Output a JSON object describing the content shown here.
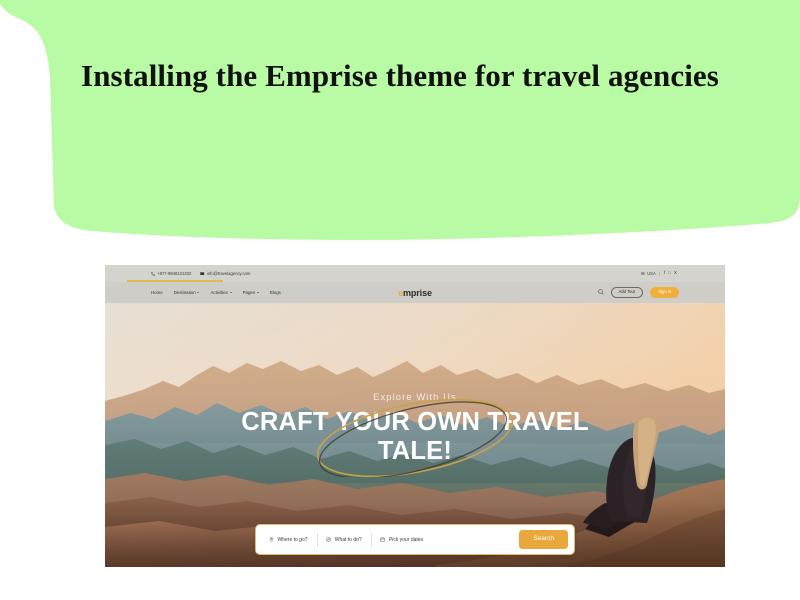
{
  "slide": {
    "title": "Installing the Emprise theme for travel agencies",
    "background_color": "#b9fba5",
    "page_background": "#ffffff"
  },
  "site": {
    "topbar": {
      "phone": "+977-9848131232",
      "phone_icon": "phone-icon",
      "email": "info@travelagency.com",
      "email_icon": "mail-icon",
      "locale": "USA",
      "locale_icon": "globe-icon",
      "separator": "|",
      "social": [
        {
          "name": "facebook-icon",
          "glyph": "f"
        },
        {
          "name": "instagram-icon",
          "glyph": "□"
        },
        {
          "name": "twitter-x-icon",
          "glyph": "X"
        }
      ]
    },
    "nav": {
      "brand_first_letter": "e",
      "brand_rest": "mprise",
      "links": [
        {
          "label": "Home",
          "has_caret": false
        },
        {
          "label": "Destination",
          "has_caret": true
        },
        {
          "label": "Activities",
          "has_caret": true
        },
        {
          "label": "Pages",
          "has_caret": true
        },
        {
          "label": "Blogs",
          "has_caret": false
        }
      ],
      "search_icon": "search-icon",
      "add_tour_label": "Add Tour",
      "sign_in_label": "Sign in",
      "accent_color": "#eeb03c"
    },
    "hero": {
      "eyebrow": "Explore With Us",
      "heading": "CRAFT YOUR OWN TRAVEL TALE!",
      "scene": "desert mountains at sunset with a woman seated on a sand dune"
    },
    "search_widget": {
      "fields": [
        {
          "label": "Where to go?",
          "icon": "location-pin-icon"
        },
        {
          "label": "What to do?",
          "icon": "compass-icon"
        },
        {
          "label": "Pick your dates",
          "icon": "calendar-icon"
        }
      ],
      "button_label": "Search",
      "button_color": "#e8a83c"
    }
  }
}
